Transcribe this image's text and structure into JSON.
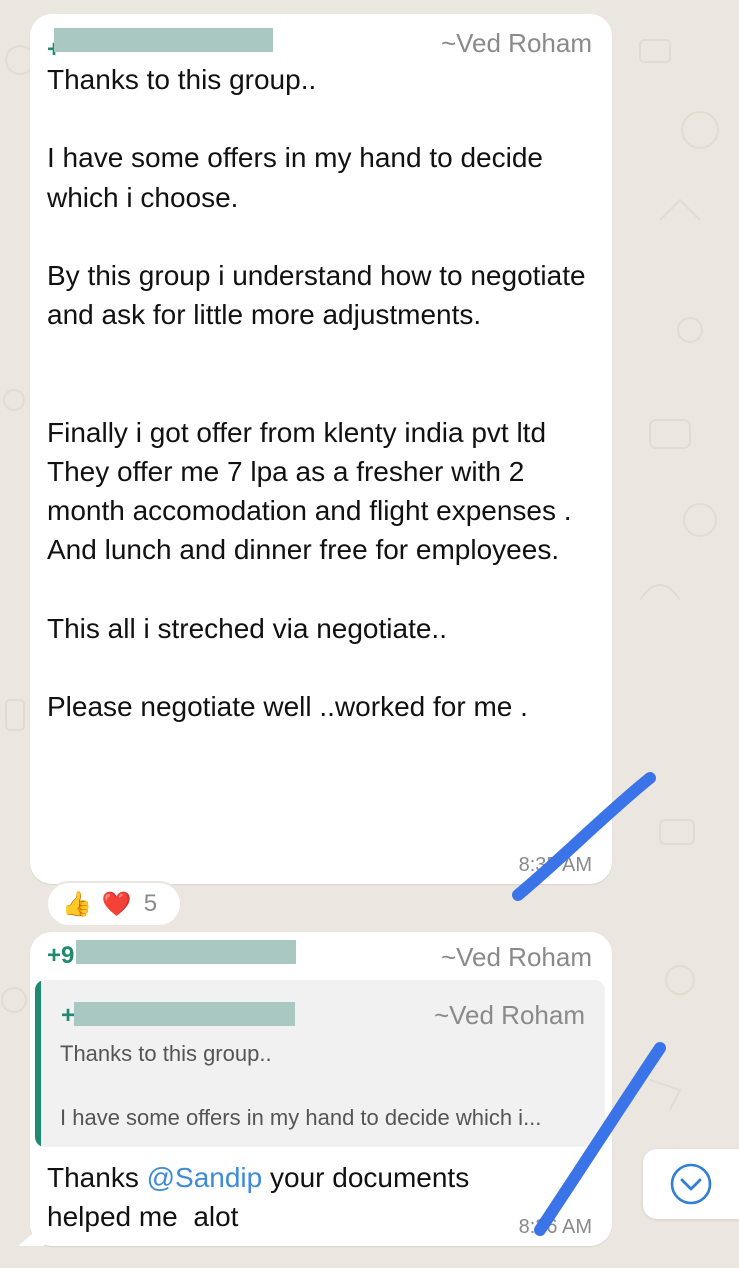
{
  "colors": {
    "accent": "#1f8a70",
    "mention": "#3d8bd9",
    "annotation": "#3b74e8"
  },
  "message1": {
    "phone_prefix": "+",
    "sender": "~Ved Roham",
    "text": "Thanks to this group..\n\nI have some offers in my hand to decide which i choose.\n\nBy this group i understand how to negotiate and ask for little more adjustments.\n\n\nFinally i got offer from klenty india pvt ltd\nThey offer me 7 lpa as a fresher with 2 month accomodation and flight expenses . And lunch and dinner free for employees.\n\nThis all i streched via negotiate..\n\nPlease negotiate well ..worked for me .",
    "time": "8:35 AM",
    "reactions": {
      "thumbs": "👍",
      "heart": "❤️",
      "count": "5"
    }
  },
  "message2": {
    "phone_prefix": "+9",
    "sender": "~Ved Roham",
    "quote": {
      "phone_prefix": "+",
      "sender": "~Ved Roham",
      "text": "Thanks to this group..\n\nI have some offers in my hand to decide which i..."
    },
    "reply_prefix": "Thanks ",
    "mention": "@Sandip",
    "reply_suffix": " your documents\nhelped me  alot",
    "time": "8:36 AM"
  },
  "scroll_down_icon": "chevron-down-circle-icon"
}
